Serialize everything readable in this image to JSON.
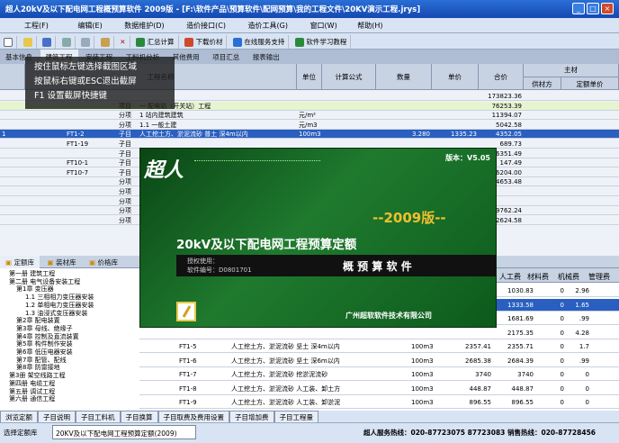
{
  "window": {
    "title": "超人20kV及以下配电网工程概预算软件 2009版 - [F:\\软件产品\\预算软件\\配网预算\\我的工程文件\\20KV演示工程.jrys]"
  },
  "menu": [
    "工程(F)",
    "编辑(E)",
    "数据维护(D)",
    "造价接口(C)",
    "造价工具(G)",
    "窗口(W)",
    "帮助(H)"
  ],
  "toolbar": [
    "汇总计算",
    "下载价材",
    "在线服务支持",
    "软件学习教程"
  ],
  "tabs": [
    "基本信息",
    "建筑工程",
    "安装工程",
    "工料机分析",
    "其他费用",
    "项目汇总",
    "报表输出"
  ],
  "overlay": [
    "按住鼠标左键选择截图区域",
    "按鼠标右键或ESC退出截屏",
    "F1 设置截屏快捷键"
  ],
  "grid": {
    "headers": [
      "工程名称",
      "单位",
      "计算公式",
      "数量",
      "单价",
      "合价",
      "主材",
      "供材方",
      "定额单价"
    ],
    "rows": [
      {
        "no": "",
        "code": "",
        "type": "",
        "name": "",
        "unit": "",
        "qty": "",
        "price": "",
        "total": "173823.36"
      },
      {
        "no": "",
        "code": "",
        "type": "项目",
        "name": "一  配电站（开关站）工程",
        "unit": "",
        "qty": "",
        "price": "",
        "total": "76253.39"
      },
      {
        "no": "",
        "code": "",
        "type": "分项",
        "name": "1  站内建筑建筑",
        "unit": "元/m²",
        "qty": "",
        "price": "",
        "total": "11394.07"
      },
      {
        "no": "",
        "code": "",
        "type": "分项",
        "name": "1.1  一般土建",
        "unit": "元/m3",
        "qty": "",
        "price": "",
        "total": "5042.58"
      },
      {
        "no": "1",
        "code": "FT1-2",
        "type": "子目",
        "name": "人工挖土方、淤泥流砂 普土 深4m以内",
        "unit": "100m3",
        "qty": "3.280",
        "price": "1335.23",
        "total": "4352.05"
      },
      {
        "no": "",
        "code": "FT1-19",
        "type": "子目",
        "name": "",
        "unit": "",
        "qty": "",
        "price": "",
        "total": "689.73"
      },
      {
        "no": "",
        "code": "",
        "type": "子目",
        "name": "",
        "unit": "",
        "qty": "",
        "price": "",
        "total": "6351.49"
      },
      {
        "no": "",
        "code": "FT10-1",
        "type": "子目",
        "name": "",
        "unit": "",
        "qty": "",
        "price": "",
        "total": "147.49"
      },
      {
        "no": "",
        "code": "FT10-7",
        "type": "子目",
        "name": "",
        "unit": "",
        "qty": "",
        "price": "",
        "total": "6204.00"
      },
      {
        "no": "",
        "code": "",
        "type": "分项",
        "name": "",
        "unit": "",
        "qty": "",
        "price": "",
        "total": "4653.48"
      },
      {
        "no": "",
        "code": "",
        "type": "分项",
        "name": "",
        "unit": "",
        "qty": "",
        "price": "",
        "total": ""
      },
      {
        "no": "",
        "code": "",
        "type": "分项",
        "name": "",
        "unit": "",
        "qty": "",
        "price": "",
        "total": ""
      },
      {
        "no": "",
        "code": "",
        "type": "分项",
        "name": "",
        "unit": "",
        "qty": "",
        "price": "",
        "total": "9762.24"
      },
      {
        "no": "",
        "code": "",
        "type": "分项",
        "name": "",
        "unit": "",
        "qty": "",
        "price": "",
        "total": "2624.58"
      }
    ]
  },
  "splash": {
    "logo": "超人",
    "version_label": "版本：V5.05",
    "year": "--2009版--",
    "title": "20kV及以下配电网工程预算定额",
    "auth": "授权使用：",
    "serial": "软件编号：D0801701",
    "product": "概 预 算 软 件",
    "company": "广州超软软件技术有限公司"
  },
  "lower": {
    "tabs": [
      "定额库",
      "装材库",
      "价格库"
    ],
    "tree": [
      "第一册 建筑工程",
      "第二册 电气设备安装工程",
      "第1章 变压器",
      "1.1 三相相力变压器安装",
      "1.2 单相电力变压器安装",
      "1.3 油浸式变压器安装",
      "第2章 配电装置",
      "第3章 母线、绝缘子",
      "第4章 控制及直流装置",
      "第5章 构件制作安装",
      "第6章 低压电器安装",
      "第7章 配管、配线",
      "第8章 防雷接地",
      "第3册 架空线路工程",
      "第四册 电缆工程",
      "第五册 调试工程",
      "第六册 通信工程"
    ],
    "headers": [
      "人工费",
      "材料费",
      "机械费",
      "管理费"
    ],
    "rows": [
      {
        "code": "",
        "name": "",
        "unit": "",
        "price": "",
        "a": "1030.83",
        "b": "0",
        "c": "2.96"
      },
      {
        "code": "",
        "name": "",
        "unit": "",
        "price": "",
        "a": "1333.58",
        "b": "0",
        "c": "1.65"
      },
      {
        "code": "",
        "name": "",
        "unit": "",
        "price": "",
        "a": "1681.69",
        "b": "0",
        "c": ".99"
      },
      {
        "code": "",
        "name": "",
        "unit": "",
        "price": "",
        "a": "2175.35",
        "b": "0",
        "c": "4.28"
      },
      {
        "code": "FT1-5",
        "name": "人工挖土方、淤泥流砂 坚土 深4m以内",
        "unit": "100m3",
        "price": "2357.41",
        "a": "2355.71",
        "b": "0",
        "c": "1.7"
      },
      {
        "code": "FT1-6",
        "name": "人工挖土方、淤泥流砂 坚土 深6m以内",
        "unit": "100m3",
        "price": "2685.38",
        "a": "2684.39",
        "b": "0",
        "c": ".99"
      },
      {
        "code": "FT1-7",
        "name": "人工挖土方、淤泥流砂 挖淤泥流砂",
        "unit": "100m3",
        "price": "3740",
        "a": "3740",
        "b": "0",
        "c": "0"
      },
      {
        "code": "FT1-8",
        "name": "人工挖土方、淤泥流砂 人工装、卸土方",
        "unit": "100m3",
        "price": "448.87",
        "a": "448.87",
        "b": "0",
        "c": "0"
      },
      {
        "code": "FT1-9",
        "name": "人工挖土方、淤泥流砂 人工装、卸淤泥",
        "unit": "100m3",
        "price": "896.55",
        "a": "896.55",
        "b": "0",
        "c": "0"
      }
    ]
  },
  "bottom_tabs": [
    "浏览定额",
    "子目说明",
    "子目工料机",
    "子目换算",
    "子目取费及费用设置",
    "子目增加费",
    "子目工程量"
  ],
  "status": {
    "label": "选择定额库",
    "db": "20KV及以下配电网工程预算定额(2009)",
    "hotline": "超人服务热线：020-87723075 87723083 销售热线：020-87728456"
  }
}
